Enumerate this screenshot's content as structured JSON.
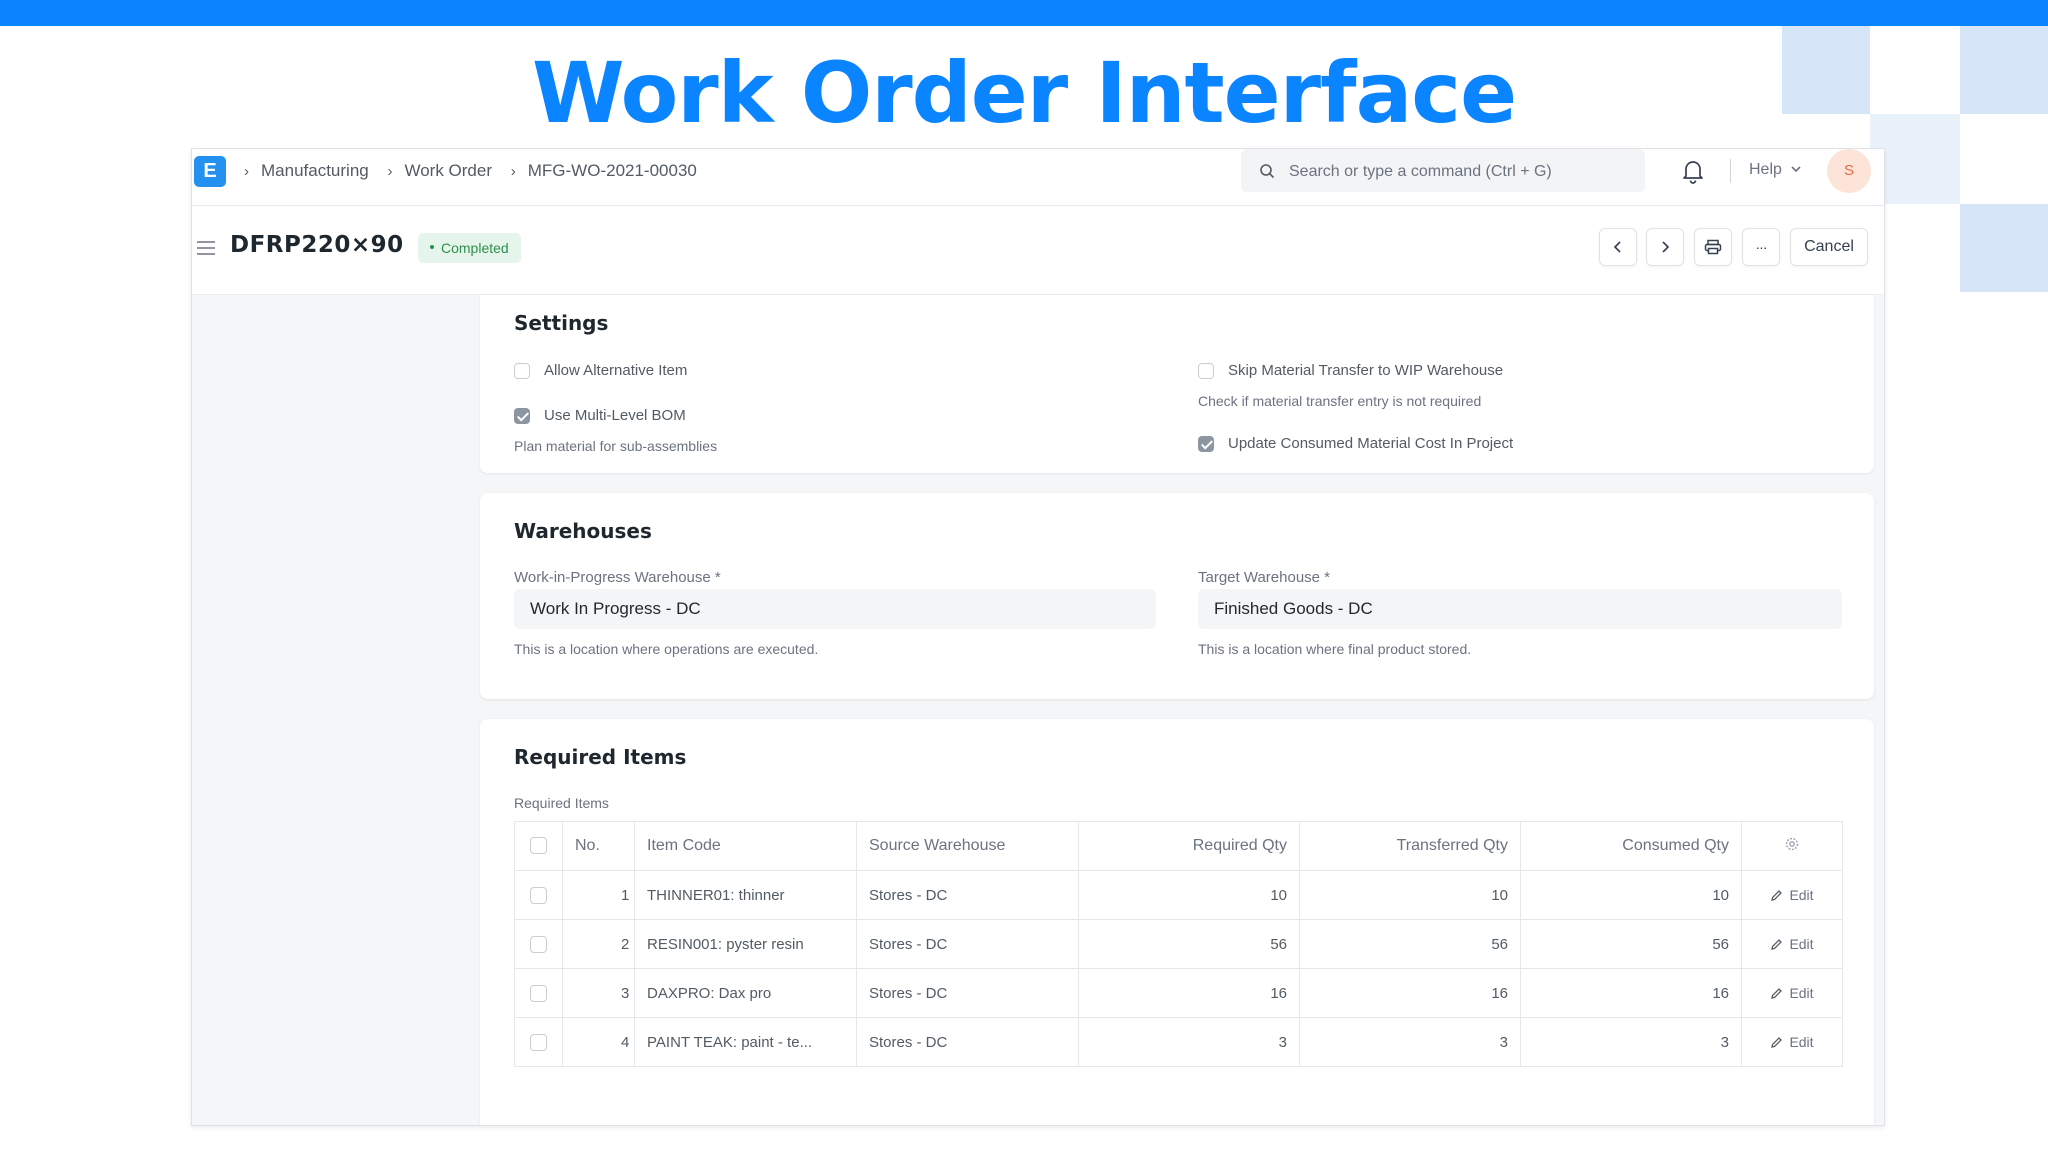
{
  "slide": {
    "title": "Work Order Interface"
  },
  "colors": {
    "accent": "#0a84ff",
    "status_green": "#2e8e4c"
  },
  "navbar": {
    "logo_letter": "E",
    "breadcrumbs": [
      "Manufacturing",
      "Work Order",
      "MFG-WO-2021-00030"
    ],
    "search_placeholder": "Search or type a command (Ctrl + G)",
    "help_label": "Help",
    "avatar_initial": "S"
  },
  "page_header": {
    "title": "DFRP220×90",
    "status": "Completed",
    "more_label": "···",
    "cancel_label": "Cancel"
  },
  "settings": {
    "title": "Settings",
    "allow_alternative_item": {
      "label": "Allow Alternative Item",
      "checked": false
    },
    "use_multi_level_bom": {
      "label": "Use Multi-Level BOM",
      "checked": true,
      "description": "Plan material for sub-assemblies"
    },
    "skip_material_transfer": {
      "label": "Skip Material Transfer to WIP Warehouse",
      "checked": false,
      "description": "Check if material transfer entry is not required"
    },
    "update_consumed_cost": {
      "label": "Update Consumed Material Cost In Project",
      "checked": true
    }
  },
  "warehouses": {
    "title": "Warehouses",
    "wip": {
      "label": "Work-in-Progress Warehouse *",
      "value": "Work In Progress - DC",
      "description": "This is a location where operations are executed."
    },
    "target": {
      "label": "Target Warehouse *",
      "value": "Finished Goods - DC",
      "description": "This is a location where final product stored."
    }
  },
  "required_items": {
    "title": "Required Items",
    "table_label": "Required Items",
    "columns": [
      "No.",
      "Item Code",
      "Source Warehouse",
      "Required Qty",
      "Transferred Qty",
      "Consumed Qty"
    ],
    "edit_label": "Edit",
    "rows": [
      {
        "no": "1",
        "item_code": "THINNER01: thinner",
        "source_warehouse": "Stores - DC",
        "required_qty": "10",
        "transferred_qty": "10",
        "consumed_qty": "10"
      },
      {
        "no": "2",
        "item_code": "RESIN001: pyster resin",
        "source_warehouse": "Stores - DC",
        "required_qty": "56",
        "transferred_qty": "56",
        "consumed_qty": "56"
      },
      {
        "no": "3",
        "item_code": "DAXPRO: Dax pro",
        "source_warehouse": "Stores - DC",
        "required_qty": "16",
        "transferred_qty": "16",
        "consumed_qty": "16"
      },
      {
        "no": "4",
        "item_code": "PAINT TEAK: paint - te...",
        "source_warehouse": "Stores - DC",
        "required_qty": "3",
        "transferred_qty": "3",
        "consumed_qty": "3"
      }
    ]
  }
}
